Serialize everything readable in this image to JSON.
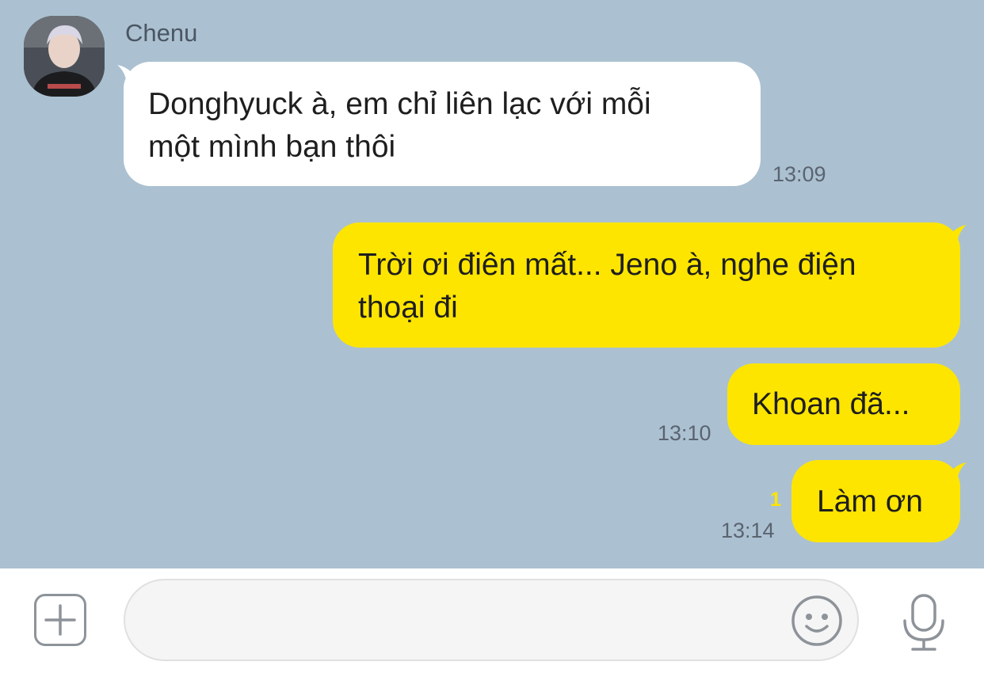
{
  "contact": {
    "name": "Chenu",
    "avatar_icon": "contact-avatar"
  },
  "messages": [
    {
      "direction": "incoming",
      "lines": [
        "Donghyuck à, em chỉ liên lạc với mỗi",
        "một mình bạn thôi"
      ],
      "time": "13:09"
    },
    {
      "direction": "outgoing",
      "lines": [
        "Trời ơi điên mất... Jeno à, nghe điện",
        "thoại đi"
      ],
      "time": ""
    },
    {
      "direction": "outgoing",
      "lines": [
        "Khoan đã..."
      ],
      "time": "13:10"
    },
    {
      "direction": "outgoing",
      "lines": [
        "Làm ơn"
      ],
      "time": "13:14",
      "unread": "1"
    }
  ],
  "composer": {
    "placeholder": "",
    "plus_icon": "plus-icon",
    "emoji_icon": "emoji-icon",
    "mic_icon": "microphone-icon"
  },
  "colors": {
    "background": "#abc1d1",
    "incoming_bubble": "#ffffff",
    "outgoing_bubble": "#fee500",
    "unread": "#fee500"
  }
}
